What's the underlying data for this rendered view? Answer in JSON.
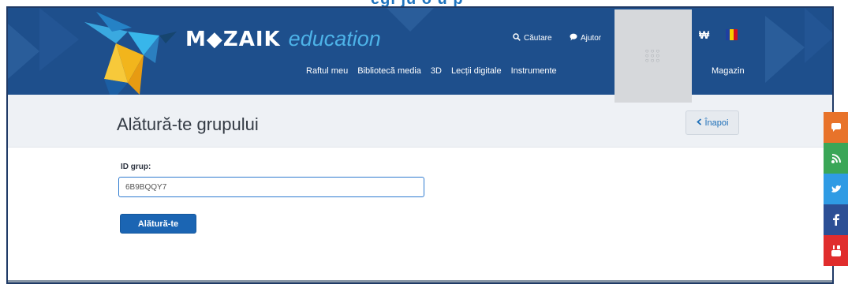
{
  "top": {
    "heading_fragment": "egi ju o u p"
  },
  "header": {
    "logo_mozaik": "M◆ZAIK",
    "logo_education": "education",
    "search_label": "Căutare",
    "help_label": "Ajutor",
    "cart_glyph": "₩",
    "flag_colors": [
      "#1e3fa0",
      "#f5d000",
      "#cf1020"
    ],
    "nav": [
      "Raftul meu",
      "Bibliotecă media",
      "3D",
      "Lecții digitale",
      "Instrumente"
    ],
    "nav_shop": "Magazin"
  },
  "page": {
    "title": "Alătură-te grupului",
    "back_label": "Înapoi"
  },
  "form": {
    "id_label": "ID grup:",
    "id_value": "6B9BQQY7",
    "join_label": "Alătură-te"
  },
  "social": [
    {
      "icon": "chat-icon",
      "color": "#e8732a",
      "glyph": "💬"
    },
    {
      "icon": "share-icon",
      "color": "#3aa657",
      "glyph": "♪"
    },
    {
      "icon": "twitter-icon",
      "color": "#2f9be4",
      "glyph": "t"
    },
    {
      "icon": "facebook-icon",
      "color": "#2c4f95",
      "glyph": "f"
    },
    {
      "icon": "youtube-icon",
      "color": "#e02d2d",
      "glyph": "▶"
    }
  ],
  "colors": {
    "header_bg": "#1e4f8c",
    "accent": "#1b65b3",
    "title_band": "#eef1f5"
  }
}
